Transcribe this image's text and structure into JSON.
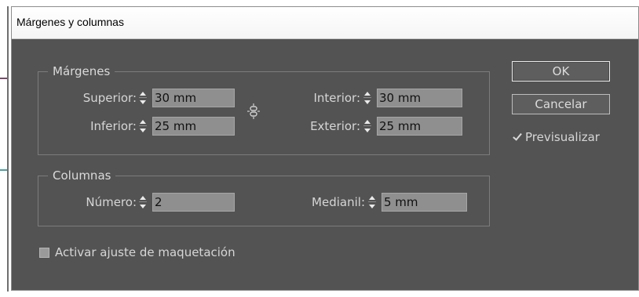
{
  "window": {
    "title": "Márgenes y columnas"
  },
  "margins": {
    "legend": "Márgenes",
    "top": {
      "label": "Superior:",
      "value": "30 mm"
    },
    "bottom": {
      "label": "Inferior:",
      "value": "25 mm"
    },
    "inside": {
      "label": "Interior:",
      "value": "30 mm"
    },
    "outside": {
      "label": "Exterior:",
      "value": "25 mm"
    },
    "link_icon": "chain-link-icon"
  },
  "columns": {
    "legend": "Columnas",
    "number": {
      "label": "Número:",
      "value": "2"
    },
    "gutter": {
      "label": "Medianil:",
      "value": "5 mm"
    }
  },
  "buttons": {
    "ok": "OK",
    "cancel": "Cancelar"
  },
  "preview": {
    "label": "Previsualizar",
    "checked": true
  },
  "layout_adjust": {
    "label": "Activar ajuste de maquetación",
    "checked": false
  },
  "colors": {
    "dialog_bg": "#535353",
    "field_bg": "#8f8f8f",
    "text": "#d6d6d6"
  }
}
